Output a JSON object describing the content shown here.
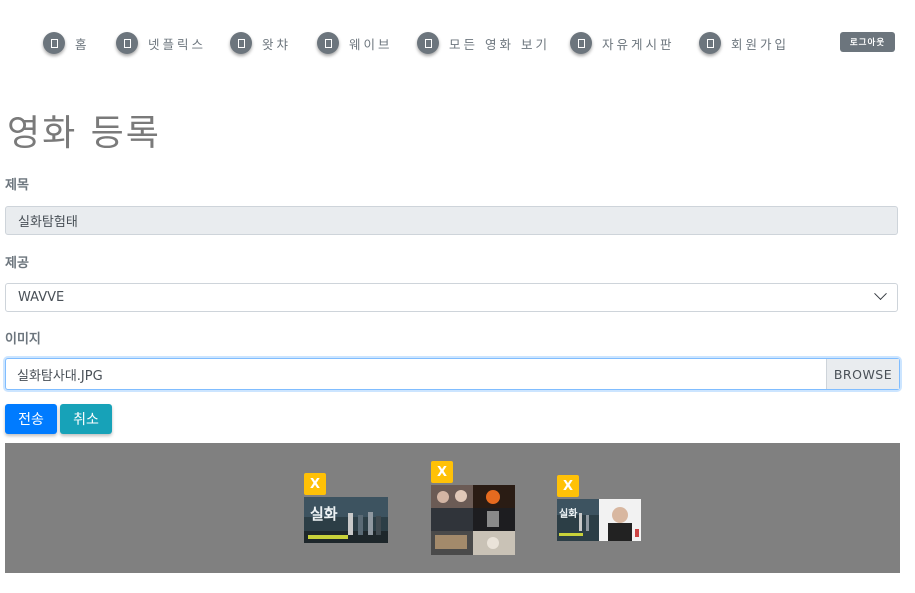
{
  "nav": {
    "items": [
      {
        "label": "홈",
        "icon": "home-icon"
      },
      {
        "label": "넷플릭스",
        "icon": "netflix-icon"
      },
      {
        "label": "왓챠",
        "icon": "watcha-icon"
      },
      {
        "label": "웨이브",
        "icon": "wavve-icon"
      },
      {
        "label": "모든 영화 보기",
        "icon": "movie-list-icon"
      },
      {
        "label": "자유게시판",
        "icon": "board-icon"
      },
      {
        "label": "회원가입",
        "icon": "signup-icon"
      }
    ],
    "logout_label": "로그아웃"
  },
  "page": {
    "title": "영화 등록"
  },
  "form": {
    "title_label": "제목",
    "title_value": "실화탐험태",
    "provider_label": "제공",
    "provider_selected": "WAVVE",
    "image_label": "이미지",
    "image_file": "실화탐사대.JPG",
    "browse_label": "BROWSE",
    "submit_label": "전송",
    "cancel_label": "취소"
  },
  "previews": {
    "remove_label": "X",
    "images": [
      {
        "name": "preview-image-1"
      },
      {
        "name": "preview-image-2"
      },
      {
        "name": "preview-image-3"
      }
    ]
  },
  "colors": {
    "primary": "#007bff",
    "info": "#17a2b8",
    "secondary": "#6c757d",
    "warning": "#ffc107",
    "preview_bg": "#808080"
  }
}
